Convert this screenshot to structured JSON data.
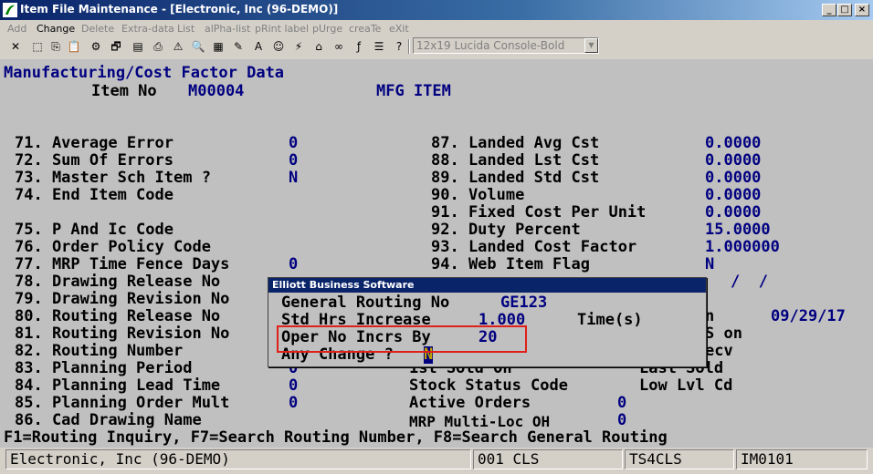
{
  "window": {
    "title": "Item File Maintenance - [Electronic, Inc (96-DEMO)]",
    "min_label": "_",
    "max_label": "□",
    "close_label": "×"
  },
  "menu": [
    {
      "label": "Add",
      "enabled": false
    },
    {
      "label": "Change",
      "enabled": true
    },
    {
      "label": "Delete",
      "enabled": false
    },
    {
      "label": "Extra-data",
      "enabled": false
    },
    {
      "label": "List",
      "enabled": false
    },
    {
      "label": "alPha-list",
      "enabled": false
    },
    {
      "label": "pRint label",
      "enabled": false
    },
    {
      "label": "pUrge",
      "enabled": false
    },
    {
      "label": "creaTe",
      "enabled": false
    },
    {
      "label": "eXit",
      "enabled": false
    }
  ],
  "toolbar": {
    "font_select": "12x19 Lucida Console-Bold"
  },
  "screen": {
    "heading": "Manufacturing/Cost Factor Data",
    "item_no_label": "Item No",
    "item_no": "M00004",
    "item_desc": "MFG ITEM",
    "left_fields": [
      {
        "label": "71. Average Error",
        "value": "0"
      },
      {
        "label": "72. Sum Of Errors",
        "value": "0"
      },
      {
        "label": "73. Master Sch Item ?",
        "value": "N"
      },
      {
        "label": "74. End Item Code",
        "value": ""
      },
      {
        "label": "75. P And Ic Code",
        "value": ""
      },
      {
        "label": "76. Order Policy Code",
        "value": ""
      },
      {
        "label": "77. MRP Time Fence Days",
        "value": "0"
      },
      {
        "label": "78. Drawing Release No",
        "value": ""
      },
      {
        "label": "79. Drawing Revision No",
        "value": ""
      },
      {
        "label": "80. Routing Release No",
        "value": ""
      },
      {
        "label": "81. Routing Revision No",
        "value": ""
      },
      {
        "label": "82. Routing Number",
        "value": ""
      },
      {
        "label": "83. Planning Period",
        "value": "0"
      },
      {
        "label": "84. Planning Lead Time",
        "value": "0"
      },
      {
        "label": "85. Planning Order Mult",
        "value": "0"
      },
      {
        "label": "86. Cad Drawing Name",
        "value": ""
      }
    ],
    "right_fields": [
      {
        "label": "87. Landed Avg Cst",
        "value": "0.0000"
      },
      {
        "label": "88. Landed Lst Cst",
        "value": "0.0000"
      },
      {
        "label": "89. Landed Std Cst",
        "value": "0.0000"
      },
      {
        "label": "90. Volume",
        "value": "0.0000"
      },
      {
        "label": "91. Fixed Cost Per Unit",
        "value": "0.0000"
      },
      {
        "label": "92. Duty Percent",
        "value": "15.0000"
      },
      {
        "label": "93. Landed Cost Factor",
        "value": "1.000000"
      },
      {
        "label": "94. Web Item Flag",
        "value": "N"
      }
    ],
    "partial_right": {
      "date_slashes": "/  /",
      "row80_tail": "n",
      "row80_date": "09/29/17",
      "row81_tail": "S on",
      "row82_tail": "ecv"
    },
    "bottom_info": {
      "first_sold_label": "1st Sold On",
      "last_sold_label": "Last Sold",
      "stock_status_label": "Stock Status Code",
      "low_lvl_label": "Low Lvl Cd",
      "active_orders_label": "Active Orders",
      "active_orders_value": "0",
      "mrp_multi_label": "MRP Multi-Loc OH",
      "mrp_multi_value": "0"
    }
  },
  "popup": {
    "title": "Elliott Business Software",
    "routing_label": "General Routing No",
    "routing_value": "GE123",
    "std_hrs_label": "Std Hrs Increase",
    "std_hrs_value": "1.000",
    "time_label": "Time(s)",
    "oper_label": "Oper No Incrs By",
    "oper_value": "20",
    "change_label": "Any Change ?",
    "change_value": "N"
  },
  "function_keys": "F1=Routing Inquiry, F7=Search Routing Number, F8=Search General Routing",
  "status_bar": {
    "company": "Electronic, Inc (96-DEMO)",
    "terminal": "001 CLS",
    "station": "TS4CLS",
    "program": "IM0101"
  }
}
